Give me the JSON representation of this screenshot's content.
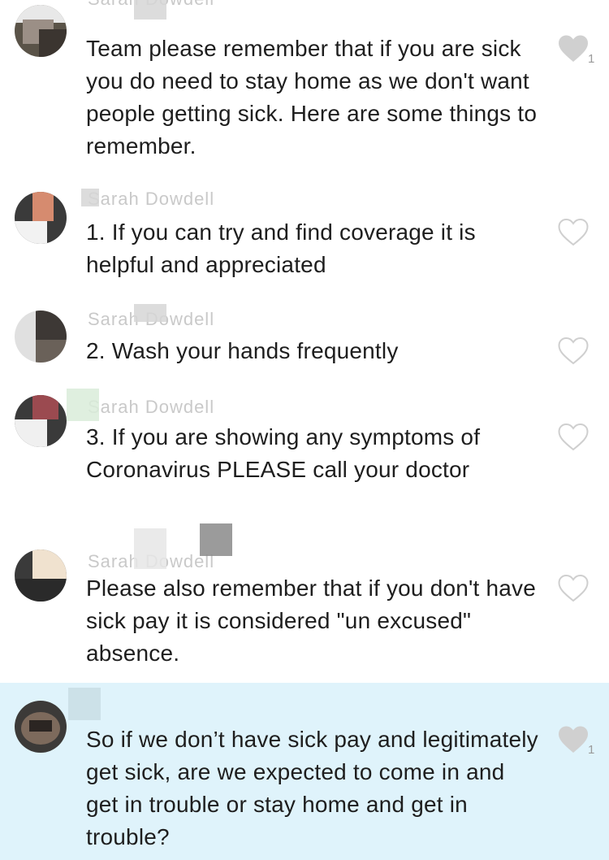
{
  "messages": [
    {
      "sender": "Sarah Dowdell",
      "text": "Team please remember that if you are sick you do need to stay home as we don't want people getting sick. Here are some things to remember.",
      "liked": true,
      "like_count": "1"
    },
    {
      "sender": "Sarah Dowdell",
      "text": "1. If you can try and find coverage it is helpful and appreciated",
      "liked": false,
      "like_count": ""
    },
    {
      "sender": "Sarah Dowdell",
      "text": "2. Wash your hands frequently",
      "liked": false,
      "like_count": ""
    },
    {
      "sender": "Sarah Dowdell",
      "text": "3. If you are showing any symptoms of Coronavirus PLEASE call your doctor",
      "liked": false,
      "like_count": ""
    },
    {
      "sender": "Sarah Dowdell",
      "text": "Please also remember that if you don't have sick pay it is considered \"un excused\" absence.",
      "liked": false,
      "like_count": ""
    },
    {
      "sender": "",
      "text": "So if we don’t have sick pay and legitimately get sick, are we expected to come in and get in trouble or stay home and get in trouble?",
      "liked": true,
      "like_count": "1",
      "highlighted": true
    }
  ],
  "colors": {
    "highlight_bg": "#dff3fb",
    "heart_filled": "#d0d0d0",
    "heart_outline": "#cfcfcf"
  }
}
